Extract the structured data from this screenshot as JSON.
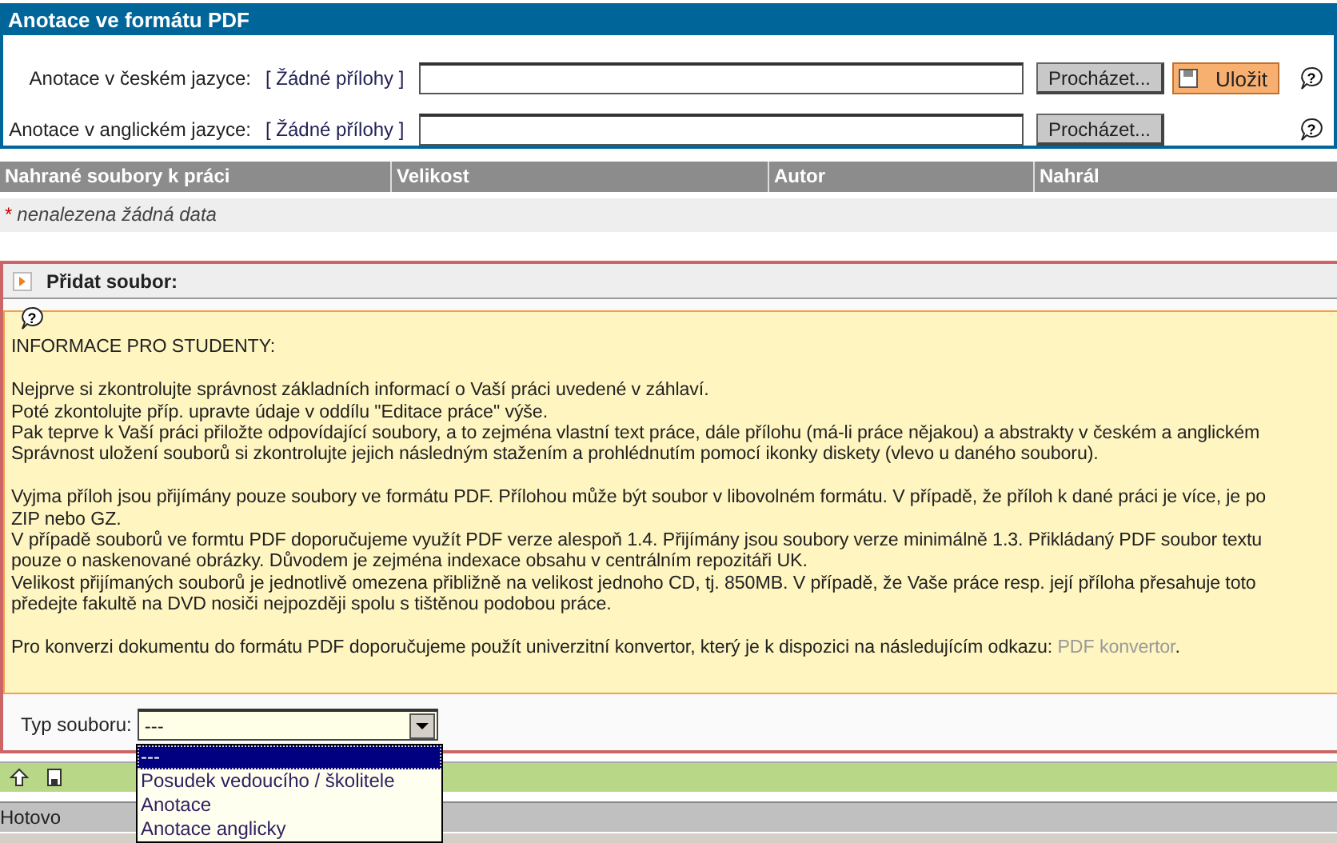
{
  "panel": {
    "title": "Anotace ve formátu PDF",
    "rows": [
      {
        "label": "Anotace v českém jazyce:",
        "attachment": "[ Žádné přílohy ]",
        "browse": "Procházet...",
        "save": "Uložit"
      },
      {
        "label": "Anotace v anglickém jazyce:",
        "attachment": "[ Žádné přílohy ]",
        "browse": "Procházet..."
      }
    ]
  },
  "table": {
    "columns": [
      "Nahrané soubory k práci",
      "Velikost",
      "Autor",
      "Nahrál"
    ],
    "empty_mark": "*",
    "empty_text": "nenalezena žádná data"
  },
  "add_section": {
    "title": "Přidat soubor:",
    "info": [
      [
        "INFORMACE PRO STUDENTY:"
      ],
      [
        "Nejprve si zkontrolujte správnost základních informací o Vaší práci uvedené v záhlaví.",
        "Poté zkontolujte příp. upravte údaje v oddílu \"Editace práce\" výše.",
        "Pak teprve k Vaší práci přiložte odpovídající soubory, a to zejména vlastní text práce, dále přílohu (má-li práce nějakou) a abstrakty v českém a anglickém",
        "Správnost uložení souborů si zkontrolujte jejich následným stažením a prohlédnutím pomocí ikonky diskety (vlevo u daného souboru)."
      ],
      [
        "Vyjma příloh jsou přijímány pouze soubory ve formátu PDF. Přílohou může být soubor v libovolném formátu. V případě, že příloh k dané práci je více, je po",
        "ZIP nebo GZ.",
        "V případě souborů ve formtu PDF doporučujeme využít PDF verze alespoň 1.4. Přijímány jsou soubory verze minimálně 1.3. Přikládaný PDF soubor textu",
        "pouze o naskenované obrázky. Důvodem je zejména indexace obsahu v centrálním repozitáři UK.",
        "Velikost přijímaných souborů je jednotlivě omezena přibližně na velikost jednoho CD, tj. 850MB. V případě, že Vaše práce resp. její příloha přesahuje toto",
        "předejte fakultě na DVD nosiči nejpozději spolu s tištěnou podobou práce."
      ]
    ],
    "conversion": {
      "text": "Pro konverzi dokumentu do formátu PDF doporučujeme použít univerzitní konvertor, který je k dispozici na následujícím odkazu:",
      "link": "PDF konvertor",
      "after": "."
    },
    "type_label": "Typ souboru:",
    "type_value": "---",
    "type_options": [
      {
        "label": "---",
        "selected": true
      },
      {
        "label": "Posudek vedoucího / školitele",
        "selected": false
      },
      {
        "label": "Anotace",
        "selected": false
      },
      {
        "label": "Anotace anglicky",
        "selected": false
      }
    ]
  },
  "status_bar": "Hotovo",
  "help_glyph": "?"
}
